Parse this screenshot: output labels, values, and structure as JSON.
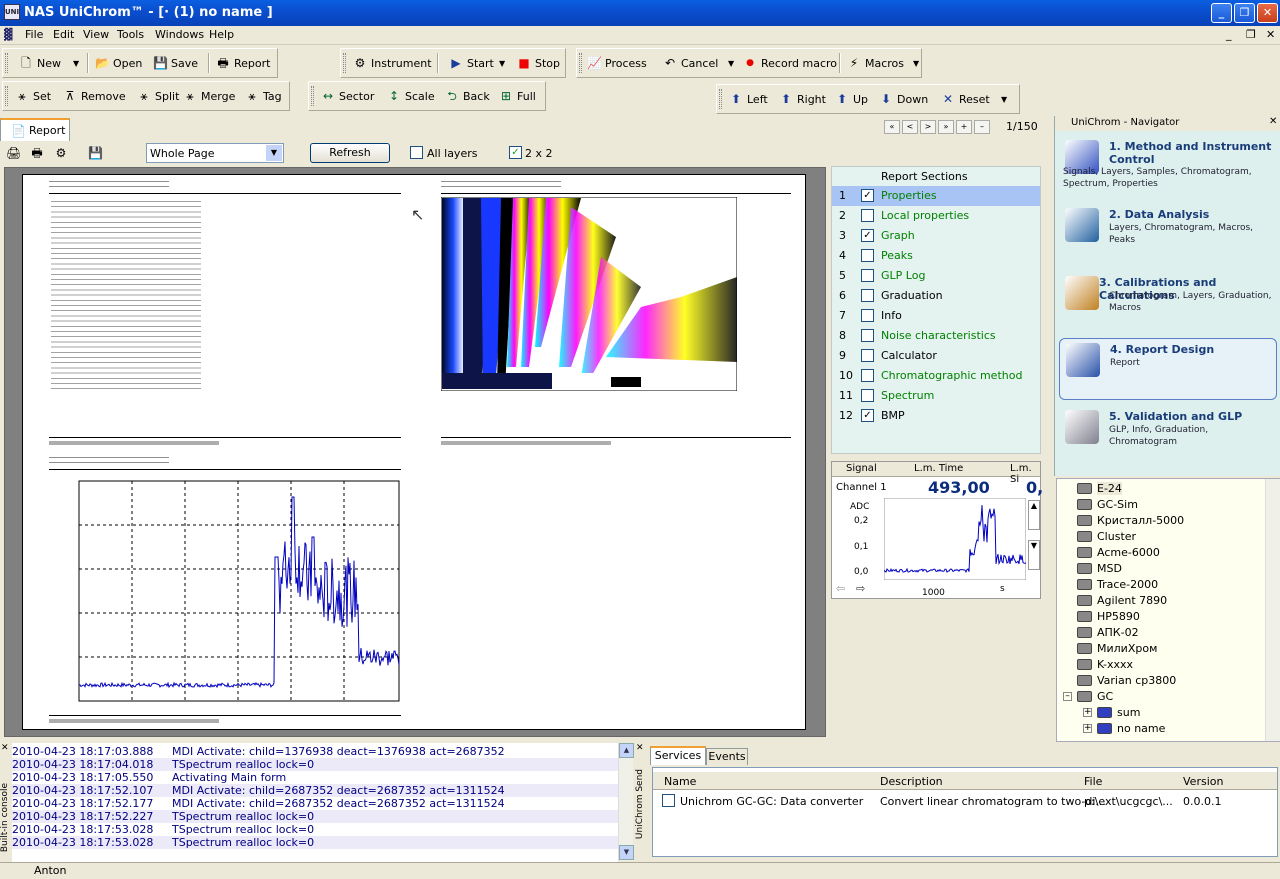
{
  "window": {
    "title": "NAS UniChrom™ - [· (1) no name ]",
    "app_icon_text": "UNI"
  },
  "menu": [
    "File",
    "Edit",
    "View",
    "Tools",
    "Windows",
    "Help"
  ],
  "toolbar1": {
    "new": "New",
    "open": "Open",
    "save": "Save",
    "report": "Report",
    "instrument": "Instrument",
    "start": "Start",
    "stop": "Stop",
    "process": "Process",
    "cancel": "Cancel",
    "record_macro": "Record macro",
    "macros": "Macros"
  },
  "toolbar2": {
    "set": "Set",
    "remove": "Remove",
    "split": "Split",
    "merge": "Merge",
    "tag": "Tag",
    "sector": "Sector",
    "scale": "Scale",
    "back": "Back",
    "full": "Full",
    "left": "Left",
    "right": "Right",
    "up": "Up",
    "down": "Down",
    "reset": "Reset"
  },
  "report_tab": {
    "label": "Report",
    "page_counter": "1/150"
  },
  "report_toolbar": {
    "zoom_value": "Whole Page",
    "refresh": "Refresh",
    "all_layers": "All layers",
    "all_layers_checked": false,
    "two_by_two": "2 x 2",
    "two_by_two_checked": true
  },
  "sections": {
    "header": "Report Sections",
    "items": [
      {
        "num": "1",
        "label": "Properties",
        "checked": true,
        "color": "#008000",
        "selected": true
      },
      {
        "num": "2",
        "label": "Local properties",
        "checked": false,
        "color": "#008000"
      },
      {
        "num": "3",
        "label": "Graph",
        "checked": true,
        "color": "#008000"
      },
      {
        "num": "4",
        "label": "Peaks",
        "checked": false,
        "color": "#008000"
      },
      {
        "num": "5",
        "label": "GLP Log",
        "checked": false,
        "color": "#008000"
      },
      {
        "num": "6",
        "label": "Graduation",
        "checked": false,
        "color": "#000000"
      },
      {
        "num": "7",
        "label": "Info",
        "checked": false,
        "color": "#000000"
      },
      {
        "num": "8",
        "label": "Noise characteristics",
        "checked": false,
        "color": "#008000"
      },
      {
        "num": "9",
        "label": "Calculator",
        "checked": false,
        "color": "#000000"
      },
      {
        "num": "10",
        "label": "Chromatographic method",
        "checked": false,
        "color": "#008000"
      },
      {
        "num": "11",
        "label": "Spectrum",
        "checked": false,
        "color": "#008000"
      },
      {
        "num": "12",
        "label": "BMP",
        "checked": true,
        "color": "#000000"
      }
    ]
  },
  "signal_panel": {
    "col_signal": "Signal",
    "col_time": "L.m. Time",
    "col_si": "L.m. Si",
    "channel": "Channel 1",
    "time_value": "493,00",
    "si_value": "0,",
    "y_unit": "ADC",
    "y_ticks": [
      "0,2",
      "0,1",
      "0,0"
    ],
    "x_tick": "1000",
    "x_unit": "s"
  },
  "navigator": {
    "title": "UniChrom - Navigator",
    "items": [
      {
        "title": "1. Method and Instrument Control",
        "sub": "Signals, Layers, Samples, Chromatogram, Spectrum, Properties",
        "icon": "method-icon"
      },
      {
        "title": "2. Data Analysis",
        "sub": "Layers, Chromatogram, Macros, Peaks",
        "icon": "analysis-icon"
      },
      {
        "title": "3. Calibrations and Calculations",
        "sub": "Chromatogram, Layers, Graduation, Macros",
        "icon": "calibration-icon"
      },
      {
        "title": "4. Report Design",
        "sub": "Report",
        "icon": "report-design-icon"
      },
      {
        "title": "5. Validation and GLP",
        "sub": "GLP, Info, Graduation, Chromatogram",
        "icon": "validation-icon"
      }
    ]
  },
  "instruments": [
    "E-24",
    "GC-Sim",
    "Кристалл-5000",
    "Cluster",
    "Acme-6000",
    "MSD",
    "Trace-2000",
    "Agilent 7890",
    "HP5890",
    "АПК-02",
    "МилиХром",
    "K-xxxx",
    "Varian cp3800",
    "GC",
    "sum",
    "no name"
  ],
  "console": {
    "label": "Built-in console",
    "rows": [
      {
        "time": "2010-04-23 18:17:03.888",
        "msg": "MDI Activate: child=1376938 deact=1376938 act=2687352"
      },
      {
        "time": "2010-04-23 18:17:04.018",
        "msg": "TSpectrum realloc lock=0"
      },
      {
        "time": "2010-04-23 18:17:05.550",
        "msg": "Activating Main form"
      },
      {
        "time": "2010-04-23 18:17:52.107",
        "msg": "MDI Activate: child=2687352 deact=2687352 act=1311524"
      },
      {
        "time": "2010-04-23 18:17:52.177",
        "msg": "MDI Activate: child=2687352 deact=2687352 act=1311524"
      },
      {
        "time": "2010-04-23 18:17:52.227",
        "msg": "TSpectrum realloc lock=0"
      },
      {
        "time": "2010-04-23 18:17:53.028",
        "msg": "TSpectrum realloc lock=0"
      },
      {
        "time": "2010-04-23 18:17:53.028",
        "msg": "TSpectrum realloc lock=0"
      }
    ]
  },
  "send_label": "UniChrom Send",
  "services": {
    "tabs": [
      "Services",
      "Events"
    ],
    "columns": [
      "Name",
      "Description",
      "File",
      "Version"
    ],
    "rows": [
      {
        "name": "Unichrom GC-GC: Data converter",
        "description": "Convert linear chromatogram to two-di...",
        "file": "p:\\ext\\ucgcgc\\...",
        "version": "0.0.0.1"
      }
    ]
  },
  "status": {
    "user": "Anton"
  }
}
